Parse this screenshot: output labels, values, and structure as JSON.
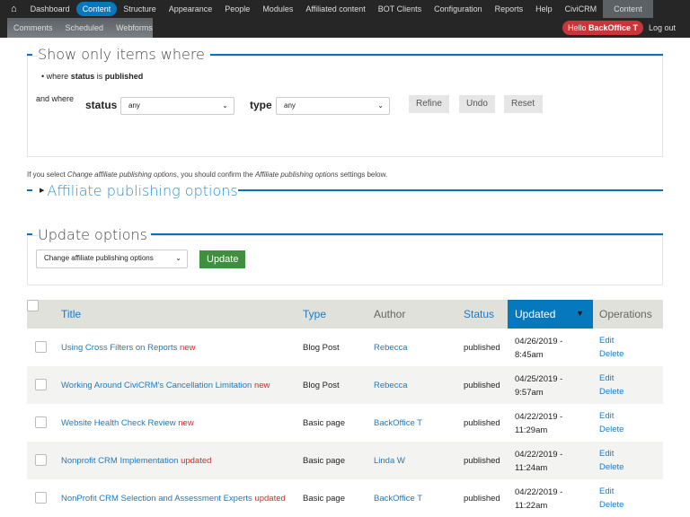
{
  "toolbar": {
    "items": [
      "Dashboard",
      "Content",
      "Structure",
      "Appearance",
      "People",
      "Modules",
      "Affiliated content",
      "BOT Clients",
      "Configuration",
      "Reports",
      "Help",
      "CiviCRM"
    ],
    "tray_label": "Content",
    "subitems": [
      "Comments",
      "Scheduled",
      "Webforms"
    ],
    "hello": "Hello",
    "user": "BackOffice T",
    "logout": "Log out"
  },
  "filter": {
    "legend": "Show only items where",
    "current_prefix": "where",
    "current_field": "status",
    "current_is": "is",
    "current_value": "published",
    "and_where": "and where",
    "status_label": "status",
    "status_value": "any",
    "type_label": "type",
    "type_value": "any",
    "refine": "Refine",
    "undo": "Undo",
    "reset": "Reset"
  },
  "help": {
    "p1": "If you select ",
    "em1": "Change affiliate publishing options",
    "p2": ", you should confirm the ",
    "em2": "Affiliate publishing options",
    "p3": " settings below."
  },
  "affiliate": {
    "legend": "Affiliate publishing options"
  },
  "update": {
    "legend": "Update options",
    "select_value": "Change affiliate publishing options",
    "button": "Update"
  },
  "table": {
    "headers": [
      "Title",
      "Type",
      "Author",
      "Status",
      "Updated",
      "Operations"
    ],
    "rows": [
      {
        "title": "Using Cross Filters on Reports",
        "flag": "new",
        "type": "Blog Post",
        "author": "Rebecca",
        "status": "published",
        "date": "04/26/2019 -",
        "time": "8:45am"
      },
      {
        "title": "Working Around CiviCRM's Cancellation Limitation",
        "flag": "new",
        "type": "Blog Post",
        "author": "Rebecca",
        "status": "published",
        "date": "04/25/2019 -",
        "time": "9:57am"
      },
      {
        "title": "Website Health Check Review",
        "flag": "new",
        "type": "Basic page",
        "author": "BackOffice T",
        "status": "published",
        "date": "04/22/2019 -",
        "time": "11:29am"
      },
      {
        "title": "Nonprofit CRM Implementation",
        "flag": "updated",
        "type": "Basic page",
        "author": "Linda W",
        "status": "published",
        "date": "04/22/2019 -",
        "time": "11:24am"
      },
      {
        "title": "NonProfit CRM Selection and Assessment Experts",
        "flag": "updated",
        "type": "Basic page",
        "author": "BackOffice T",
        "status": "published",
        "date": "04/22/2019 -",
        "time": "11:22am"
      }
    ],
    "edit": "Edit",
    "delete": "Delete"
  }
}
